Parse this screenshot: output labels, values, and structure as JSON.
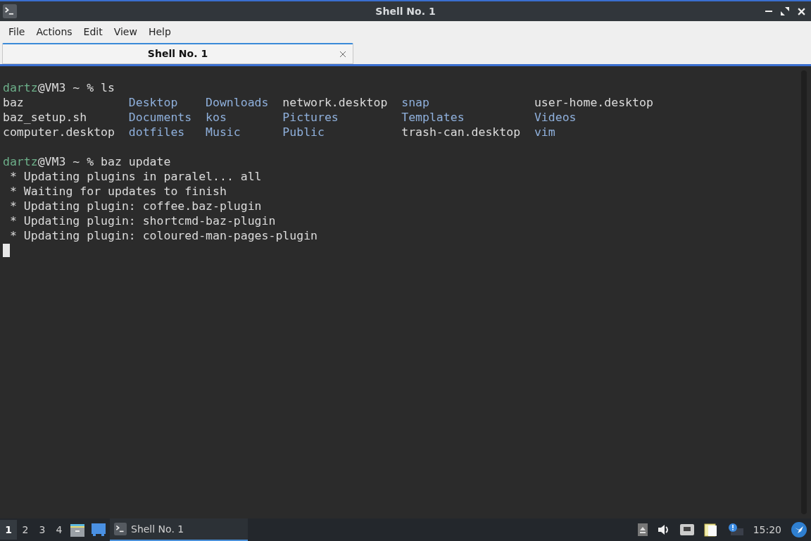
{
  "window": {
    "title": "Shell No. 1"
  },
  "menu": [
    "File",
    "Actions",
    "Edit",
    "View",
    "Help"
  ],
  "tabs": [
    {
      "label": "Shell No. 1",
      "selected": true
    }
  ],
  "terminal": {
    "blocks": [
      {
        "kind": "prompt",
        "user": "dartz",
        "rest": "@VM3 ~ % ls"
      },
      {
        "kind": "listing",
        "rows": [
          [
            {
              "name": "baz",
              "kind": "file"
            },
            {
              "name": "Desktop",
              "kind": "dir"
            },
            {
              "name": "Downloads",
              "kind": "dir"
            },
            {
              "name": "network.desktop",
              "kind": "file"
            },
            {
              "name": "snap",
              "kind": "dir"
            },
            {
              "name": "user-home.desktop",
              "kind": "file"
            }
          ],
          [
            {
              "name": "baz_setup.sh",
              "kind": "file"
            },
            {
              "name": "Documents",
              "kind": "dir"
            },
            {
              "name": "kos",
              "kind": "dir"
            },
            {
              "name": "Pictures",
              "kind": "dir"
            },
            {
              "name": "Templates",
              "kind": "dir"
            },
            {
              "name": "Videos",
              "kind": "dir"
            }
          ],
          [
            {
              "name": "computer.desktop",
              "kind": "file"
            },
            {
              "name": "dotfiles",
              "kind": "dir"
            },
            {
              "name": "Music",
              "kind": "dir"
            },
            {
              "name": "Public",
              "kind": "dir"
            },
            {
              "name": "trash-can.desktop",
              "kind": "file"
            },
            {
              "name": "vim",
              "kind": "dir"
            }
          ]
        ]
      },
      {
        "kind": "blank"
      },
      {
        "kind": "prompt",
        "user": "dartz",
        "rest": "@VM3 ~ % baz update"
      },
      {
        "kind": "output",
        "text": " * Updating plugins in paralel... all"
      },
      {
        "kind": "output",
        "text": " * Waiting for updates to finish"
      },
      {
        "kind": "output",
        "text": " * Updating plugin: coffee.baz-plugin"
      },
      {
        "kind": "output",
        "text": " * Updating plugin: shortcmd-baz-plugin"
      },
      {
        "kind": "output",
        "text": " * Updating plugin: coloured-man-pages-plugin"
      },
      {
        "kind": "cursor"
      }
    ]
  },
  "taskbar": {
    "desktops": [
      {
        "label": "1",
        "selected": true
      },
      {
        "label": "2",
        "selected": false
      },
      {
        "label": "3",
        "selected": false
      },
      {
        "label": "4",
        "selected": false
      }
    ],
    "tasks": [
      {
        "label": "Shell No. 1",
        "selected": true
      }
    ],
    "clock": "15:20"
  }
}
